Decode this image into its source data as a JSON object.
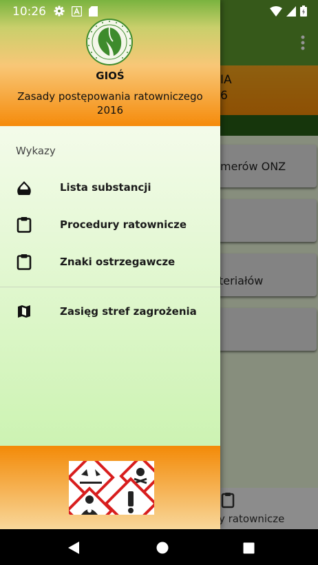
{
  "status_bar": {
    "time": "10:26"
  },
  "background": {
    "header_line1": "IA",
    "header_line2": "6",
    "cards": [
      "merów ONZ",
      "",
      "teriałów",
      ""
    ],
    "bottom_label": "y ratownicze"
  },
  "drawer": {
    "title": "GIOŚ",
    "subtitle": "Zasady postępowania ratowniczego 2016",
    "section_label": "Wykazy",
    "items": [
      {
        "label": "Lista substancji",
        "icon": "drop-icon"
      },
      {
        "label": "Procedury ratownicze",
        "icon": "clipboard-icon"
      },
      {
        "label": "Znaki ostrzegawcze",
        "icon": "clipboard-icon"
      },
      {
        "label": "Zasięg stref zagrożenia",
        "icon": "map-icon"
      }
    ]
  },
  "colors": {
    "header_orange": "#f58b0b",
    "toolbar_green": "#5e9a2e",
    "drawer_bg": "#f3fbe9"
  }
}
